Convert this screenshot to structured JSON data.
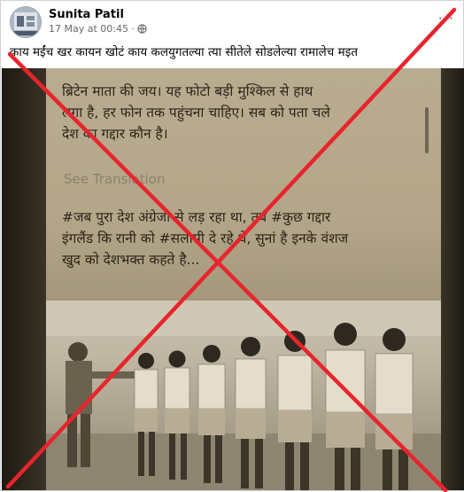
{
  "post": {
    "author": "Sunita Patil",
    "timestamp": "17 May at 00:45 ·",
    "more_label": "···",
    "text": "काय मईंच खर कायन खोटं काय कलयुगतल्या त्या सीतेले सोडलेल्या रामालेच मइत"
  },
  "image_text": {
    "line1": "ब्रिटेन माता की जय। यह फोटो बड़ी मुश्किल से हाथ",
    "line2": "लगा है, हर फोन तक पहुंचना चाहिए। सब को पता चले",
    "line3": "देश का गद्दार कौन है।",
    "see_translation": "See Translation",
    "line4": "#जब पुरा देश अंग्रेजो से लड़ रहा था, तब #कुछ गद्दार",
    "line5": "इंगलैंड कि रानी को #सलामी दे रहे थे, सुनां है इनके वंशज",
    "line6": "खुद को देशभक्त कहते है..."
  },
  "colors": {
    "cross": "#e8242c",
    "author": "#050505",
    "meta": "#65676b"
  },
  "icons": [
    "avatar",
    "globe-icon",
    "more-options-icon",
    "cross-mark"
  ]
}
